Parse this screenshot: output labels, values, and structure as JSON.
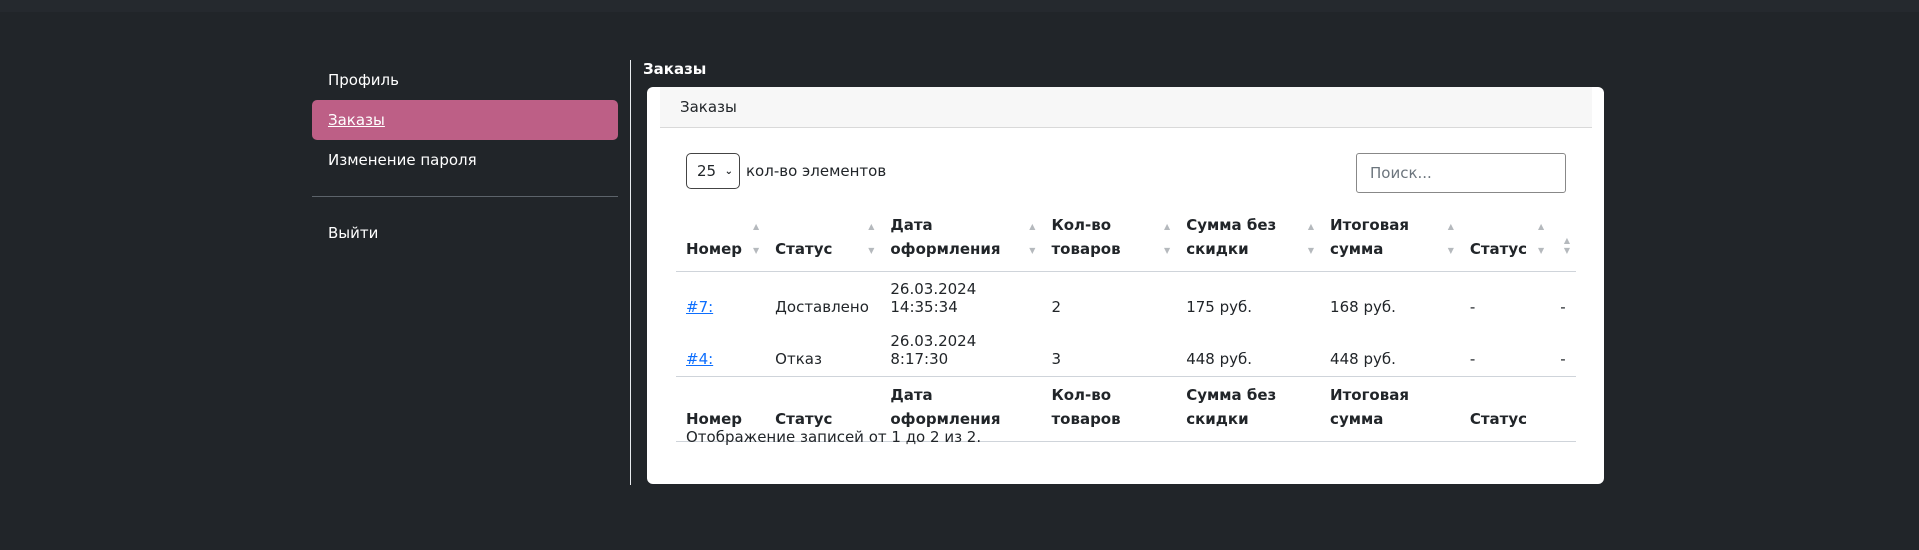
{
  "sidebar": {
    "items": [
      {
        "label": "Профиль",
        "active": false
      },
      {
        "label": "Заказы",
        "active": true
      },
      {
        "label": "Изменение пароля",
        "active": false
      }
    ],
    "logout_label": "Выйти"
  },
  "main": {
    "title": "Заказы",
    "card_header": "Заказы",
    "length": {
      "value": "25",
      "label": "кол-во элементов"
    },
    "search": {
      "placeholder": "Поиск..."
    },
    "columns": [
      {
        "line1": "",
        "line2": "Номер"
      },
      {
        "line1": "",
        "line2": "Статус"
      },
      {
        "line1": "Дата",
        "line2": "оформления"
      },
      {
        "line1": "Кол-во",
        "line2": "товаров"
      },
      {
        "line1": "Сумма без",
        "line2": "скидки"
      },
      {
        "line1": "Итоговая",
        "line2": "сумма"
      },
      {
        "line1": "",
        "line2": "Статус"
      },
      {
        "line1": "",
        "line2": ""
      }
    ],
    "rows": [
      {
        "number": "#7:",
        "status": "Доставлено",
        "date": "26.03.2024 14:35:34",
        "qty": "2",
        "sum": "175 руб.",
        "total": "168 руб.",
        "status2": "-",
        "extra": "-"
      },
      {
        "number": "#4:",
        "status": "Отказ",
        "date": "26.03.2024 8:17:30",
        "qty": "3",
        "sum": "448 руб.",
        "total": "448 руб.",
        "status2": "-",
        "extra": "-"
      }
    ],
    "info": "Отображение записей от 1 до 2 из 2."
  },
  "colors": {
    "background": "#212529",
    "active_nav": "#bd5f86",
    "link": "#0d6efd"
  }
}
